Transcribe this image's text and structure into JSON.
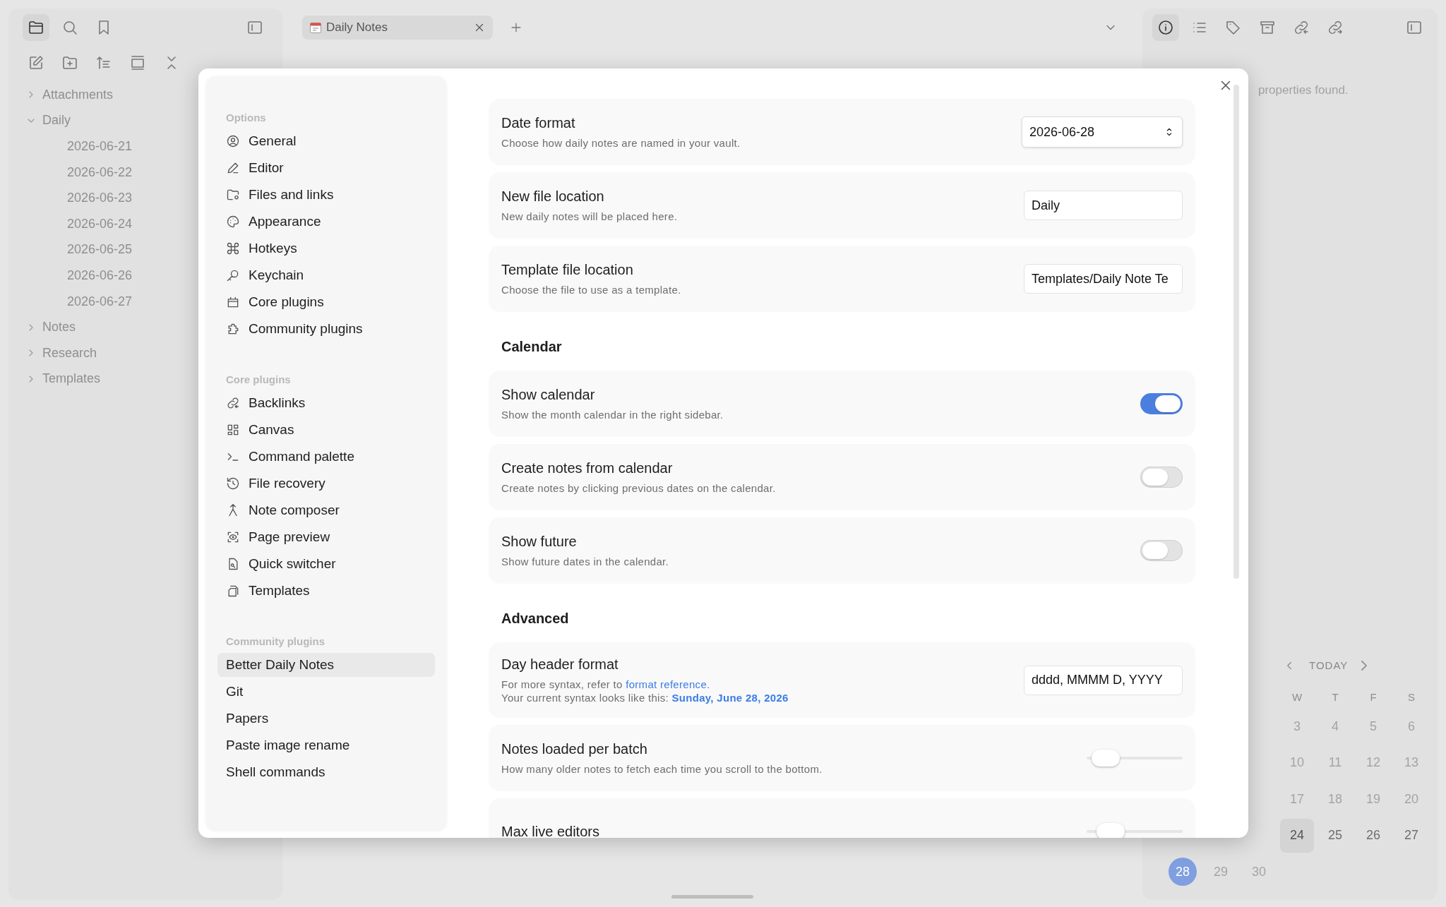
{
  "left_sidebar": {
    "view_tabs": [
      {
        "selected": true
      },
      {
        "selected": false
      },
      {
        "selected": false
      }
    ],
    "file_tree": [
      {
        "label": "Attachments",
        "expanded": false
      },
      {
        "label": "Daily",
        "expanded": true,
        "children": [
          {
            "label": "2026-06-21"
          },
          {
            "label": "2026-06-22"
          },
          {
            "label": "2026-06-23"
          },
          {
            "label": "2026-06-24"
          },
          {
            "label": "2026-06-25"
          },
          {
            "label": "2026-06-26"
          },
          {
            "label": "2026-06-27"
          }
        ]
      },
      {
        "label": "Notes",
        "expanded": false
      },
      {
        "label": "Research",
        "expanded": false
      },
      {
        "label": "Templates",
        "expanded": false
      }
    ]
  },
  "tabs": [
    {
      "label": "Daily Notes",
      "selected": true
    }
  ],
  "right_sidebar": {
    "view_tabs": [
      {
        "selected": true
      },
      {
        "selected": false
      },
      {
        "selected": false
      },
      {
        "selected": false
      },
      {
        "selected": false
      },
      {
        "selected": false
      }
    ],
    "empty_message": "properties found.",
    "calendar": {
      "nav_label": "TODAY",
      "weekdays": [
        "W",
        "T",
        "F",
        "S"
      ],
      "weeks": [
        {
          "kind": "week_end",
          "days": [
            {
              "label": "3",
              "kind": "faded"
            },
            {
              "label": "4",
              "kind": "faded"
            },
            {
              "label": "5",
              "kind": "faded"
            },
            {
              "label": "6",
              "kind": "faded"
            }
          ]
        },
        {
          "kind": "week_end",
          "days": [
            {
              "label": "10",
              "kind": "faded"
            },
            {
              "label": "11",
              "kind": "faded"
            },
            {
              "label": "12",
              "kind": "faded"
            },
            {
              "label": "13",
              "kind": "faded"
            }
          ]
        },
        {
          "kind": "week_end",
          "days": [
            {
              "label": "17",
              "kind": "faded"
            },
            {
              "label": "18",
              "kind": "faded"
            },
            {
              "label": "19",
              "kind": "faded"
            },
            {
              "label": "20",
              "kind": "faded"
            }
          ]
        },
        {
          "kind": "week_end",
          "days": [
            {
              "label": "24",
              "kind": "active"
            },
            {
              "label": "25",
              "kind": "note"
            },
            {
              "label": "26",
              "kind": "note"
            },
            {
              "label": "27",
              "kind": "note"
            }
          ]
        },
        {
          "kind": "week_start",
          "days": [
            {
              "label": "28",
              "kind": "today"
            },
            {
              "label": "29",
              "kind": "faded"
            },
            {
              "label": "30",
              "kind": "faded"
            }
          ]
        }
      ]
    }
  },
  "settings_modal": {
    "nav_sections": [
      {
        "heading": "Options",
        "items": [
          {
            "label": "General",
            "selected": false
          },
          {
            "label": "Editor",
            "selected": false
          },
          {
            "label": "Files and links",
            "selected": false
          },
          {
            "label": "Appearance",
            "selected": false
          },
          {
            "label": "Hotkeys",
            "selected": false
          },
          {
            "label": "Keychain",
            "selected": false
          },
          {
            "label": "Core plugins",
            "selected": false
          },
          {
            "label": "Community plugins",
            "selected": false
          }
        ]
      },
      {
        "heading": "Core plugins",
        "items": [
          {
            "label": "Backlinks",
            "selected": false
          },
          {
            "label": "Canvas",
            "selected": false
          },
          {
            "label": "Command palette",
            "selected": false
          },
          {
            "label": "File recovery",
            "selected": false
          },
          {
            "label": "Note composer",
            "selected": false
          },
          {
            "label": "Page preview",
            "selected": false
          },
          {
            "label": "Quick switcher",
            "selected": false
          },
          {
            "label": "Templates",
            "selected": false
          }
        ]
      },
      {
        "heading": "Community plugins",
        "items": [
          {
            "label": "Better Daily Notes",
            "selected": true
          },
          {
            "label": "Git",
            "selected": false
          },
          {
            "label": "Papers",
            "selected": false
          },
          {
            "label": "Paste image rename",
            "selected": false
          },
          {
            "label": "Shell commands",
            "selected": false
          }
        ]
      }
    ],
    "content": [
      {
        "kind": "dropdown",
        "title": "Date format",
        "description": "Choose how daily notes are named in your vault.",
        "value": "2026-06-28"
      },
      {
        "kind": "text",
        "title": "New file location",
        "description": "New daily notes will be placed here.",
        "value": "Daily"
      },
      {
        "kind": "text",
        "title": "Template file location",
        "description": "Choose the file to use as a template.",
        "value": "Templates/Daily Note Te"
      },
      {
        "kind": "heading",
        "title": "Calendar"
      },
      {
        "kind": "toggle",
        "title": "Show calendar",
        "description": "Show the month calendar in the right sidebar.",
        "on": true
      },
      {
        "kind": "toggle",
        "title": "Create notes from calendar",
        "description": "Create notes by clicking previous dates on the calendar.",
        "on": false
      },
      {
        "kind": "toggle",
        "title": "Show future",
        "description": "Show future dates in the calendar.",
        "on": false
      },
      {
        "kind": "heading",
        "title": "Advanced"
      },
      {
        "kind": "text",
        "title": "Day header format",
        "description": "For more syntax, refer to",
        "link": "format reference.",
        "note": "Your current syntax looks like this: **Sunday, June 28, 2026**",
        "value": "dddd, MMMM D, YYYY"
      },
      {
        "kind": "slider",
        "title": "Notes loaded per batch",
        "description": "How many older notes to fetch each time you scroll to the bottom.",
        "level": 0.2
      },
      {
        "kind": "slider",
        "title": "Max live editors",
        "level": 0.25
      }
    ]
  }
}
